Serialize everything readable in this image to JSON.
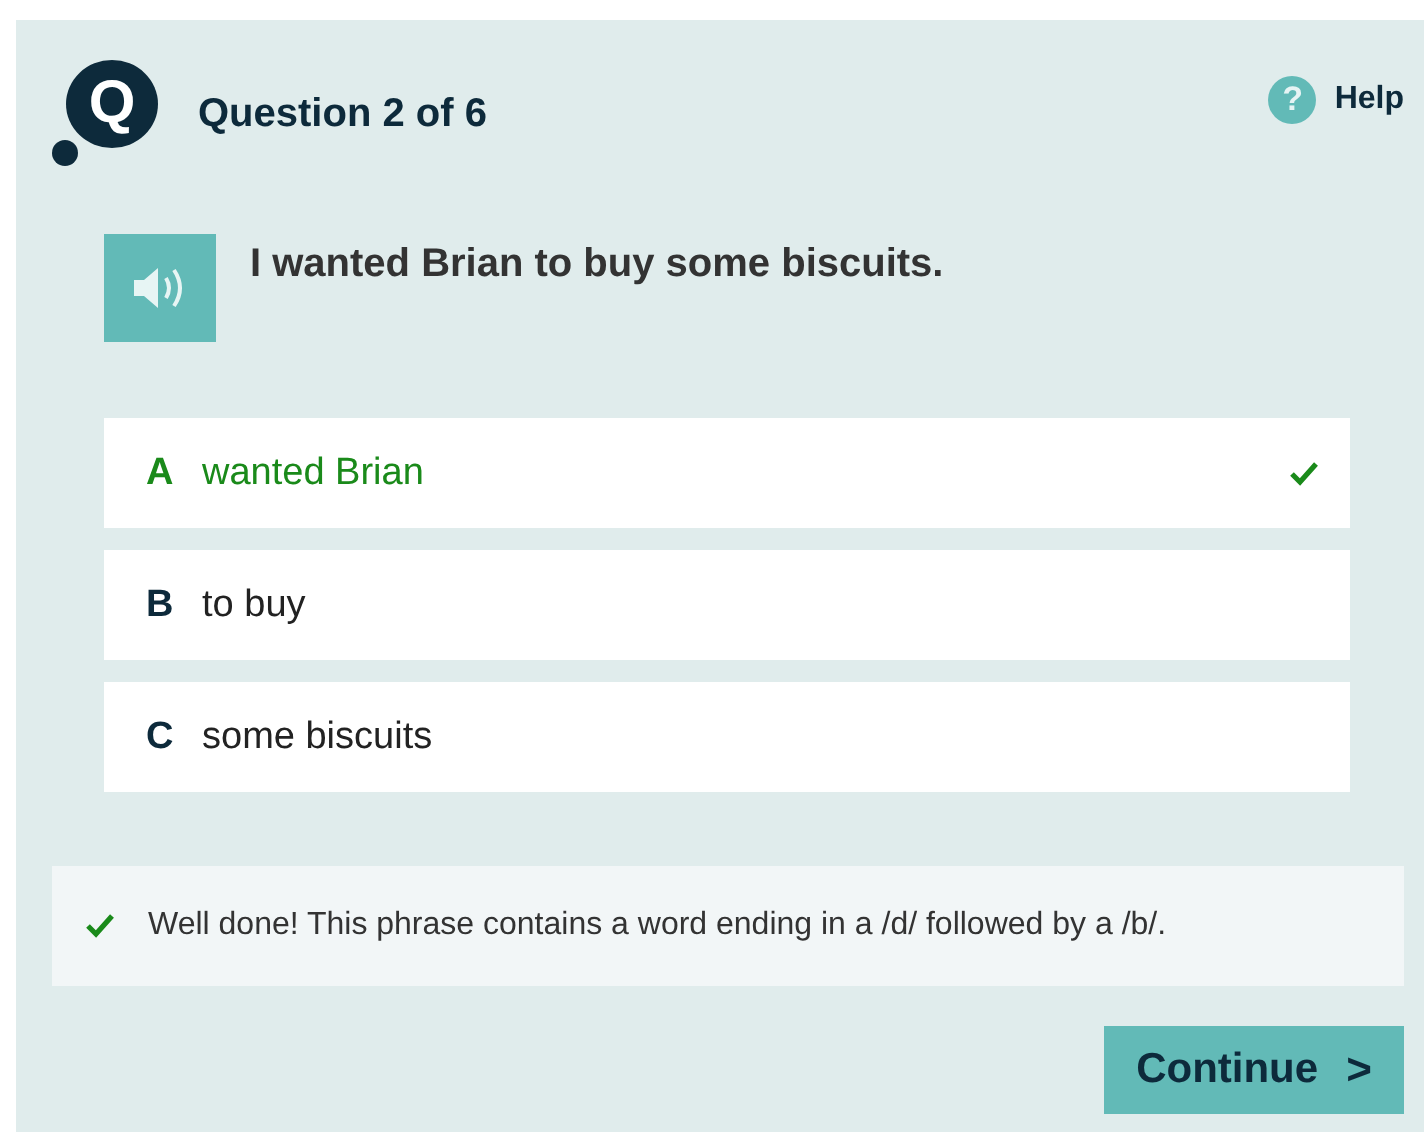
{
  "header": {
    "logo_letter": "Q",
    "title": "Question 2 of 6",
    "help": {
      "icon": "?",
      "label": "Help"
    }
  },
  "question": {
    "sentence": "I wanted Brian to buy some biscuits."
  },
  "options": [
    {
      "letter": "A",
      "text": "wanted Brian",
      "selected": true
    },
    {
      "letter": "B",
      "text": "to buy",
      "selected": false
    },
    {
      "letter": "C",
      "text": "some biscuits",
      "selected": false
    }
  ],
  "feedback": {
    "kind": "correct",
    "text": "Well done! This phrase contains a word ending in a /d/ followed by a /b/."
  },
  "continue_button": {
    "label": "Continue",
    "chevron": ">"
  }
}
